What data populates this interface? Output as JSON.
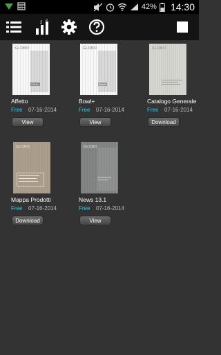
{
  "status_bar": {
    "battery": "42%",
    "time": "14:30"
  },
  "toolbar": {
    "icons": [
      "list-icon",
      "stats-icon",
      "gear-icon",
      "help-icon",
      "stop-icon"
    ]
  },
  "library": {
    "items": [
      {
        "title": "Affetto",
        "price": "Free",
        "date": "07-16-2014",
        "action": "View",
        "cover_brand": "GLOBO",
        "cover_caption": "Affetto"
      },
      {
        "title": "Bowl+",
        "price": "Free",
        "date": "07-16-2014",
        "action": "View",
        "cover_brand": "GLOBO",
        "cover_caption": "Bowl+"
      },
      {
        "title": "Catalogo Generale",
        "price": "Free",
        "date": "07-16-2014",
        "action": "Download",
        "cover_brand": "GLOBO",
        "cover_caption": ""
      },
      {
        "title": "Mappa Prodotti",
        "price": "Free",
        "date": "07-16-2014",
        "action": "Download",
        "cover_brand": "GLOBO",
        "cover_caption": ""
      },
      {
        "title": "News 13.1",
        "price": "Free",
        "date": "07-16-2014",
        "action": "View",
        "cover_brand": "GLOBO",
        "cover_caption": ""
      }
    ]
  },
  "colors": {
    "background": "#333333",
    "toolbar": "#141414",
    "price": "#38c8e8"
  }
}
